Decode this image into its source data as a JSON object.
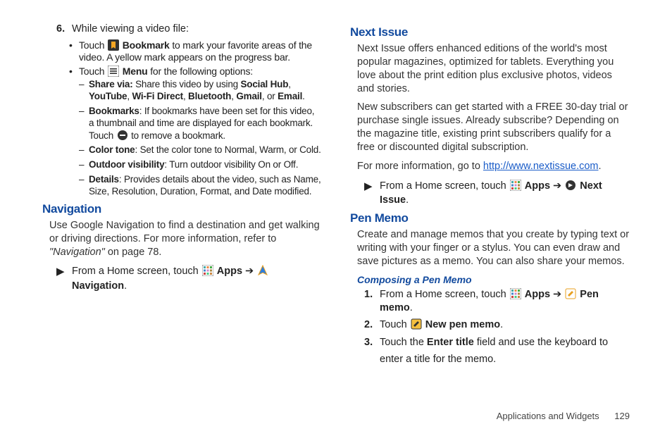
{
  "left": {
    "step6_num": "6.",
    "step6_text": "While viewing a video file:",
    "b1_a": "Touch ",
    "b1_b": "Bookmark",
    "b1_c": " to mark your favorite areas of the video. A yellow mark appears on the progress bar.",
    "b2_a": "Touch ",
    "b2_b": "Menu",
    "b2_c": " for the following options:",
    "d1_a": "Share via: ",
    "d1_b": "Share this video by using ",
    "d1_c": "Social Hub",
    "d1_d": ", ",
    "d1_e": "YouTube",
    "d1_f": ", ",
    "d1_g": "Wi-Fi Direct",
    "d1_h": ", ",
    "d1_i": "Bluetooth",
    "d1_j": ", ",
    "d1_k": "Gmail",
    "d1_l": ", or ",
    "d1_m": "Email",
    "d1_n": ".",
    "d2_a": "Bookmarks",
    "d2_b": ": If bookmarks have been set for this video, a thumbnail and time are displayed for each bookmark. Touch ",
    "d2_c": " to remove a bookmark.",
    "d3_a": "Color tone",
    "d3_b": ": Set the color tone to Normal, Warm, or Cold.",
    "d4_a": "Outdoor visibility",
    "d4_b": ": Turn outdoor visibility On or Off.",
    "d5_a": "Details",
    "d5_b": ": Provides details about the video, such as Name, Size, Resolution, Duration, Format, and Date modified.",
    "nav_h": "Navigation",
    "nav_p1": "Use Google Navigation to find a destination and get walking or driving directions. For more information, refer to ",
    "nav_ref": "\"Navigation\"",
    "nav_p2": " on page 78.",
    "nav_step_a": "From a Home screen, touch ",
    "nav_step_b": "Apps",
    "nav_step_arrow": " ➔ ",
    "nav_step_c": "Navigation",
    "nav_step_d": "."
  },
  "right": {
    "ni_h": "Next Issue",
    "ni_p1": "Next Issue offers enhanced editions of the world's most popular magazines, optimized for tablets. Everything you love about the print edition plus exclusive photos, videos and stories.",
    "ni_p2": "New subscribers can get started with a FREE 30-day trial or purchase single issues. Already subscribe? Depending on the magazine title, existing print subscribers qualify for a free or discounted digital subscription.",
    "ni_p3a": "For more information, go to ",
    "ni_link": "http://www.nextissue.com",
    "ni_p3b": ".",
    "ni_step_a": "From a Home screen, touch ",
    "ni_step_b": "Apps",
    "ni_step_arrow": " ➔ ",
    "ni_step_c": "Next Issue",
    "ni_step_d": ".",
    "pm_h": "Pen Memo",
    "pm_p": "Create and manage memos that you create by typing text or writing with your finger or a stylus. You can even draw and save pictures as a memo. You can also share your memos.",
    "pm_sub": "Composing a Pen Memo",
    "pm1_n": "1.",
    "pm1_a": "From a Home screen, touch ",
    "pm1_b": "Apps",
    "pm1_arrow": " ➔ ",
    "pm1_c": "Pen memo",
    "pm1_d": ".",
    "pm2_n": "2.",
    "pm2_a": "Touch ",
    "pm2_b": "New pen memo",
    "pm2_c": ".",
    "pm3_n": "3.",
    "pm3_a": "Touch the ",
    "pm3_b": "Enter title",
    "pm3_c": " field and use the keyboard to enter a title for the memo."
  },
  "footer": {
    "section": "Applications and Widgets",
    "page": "129"
  }
}
